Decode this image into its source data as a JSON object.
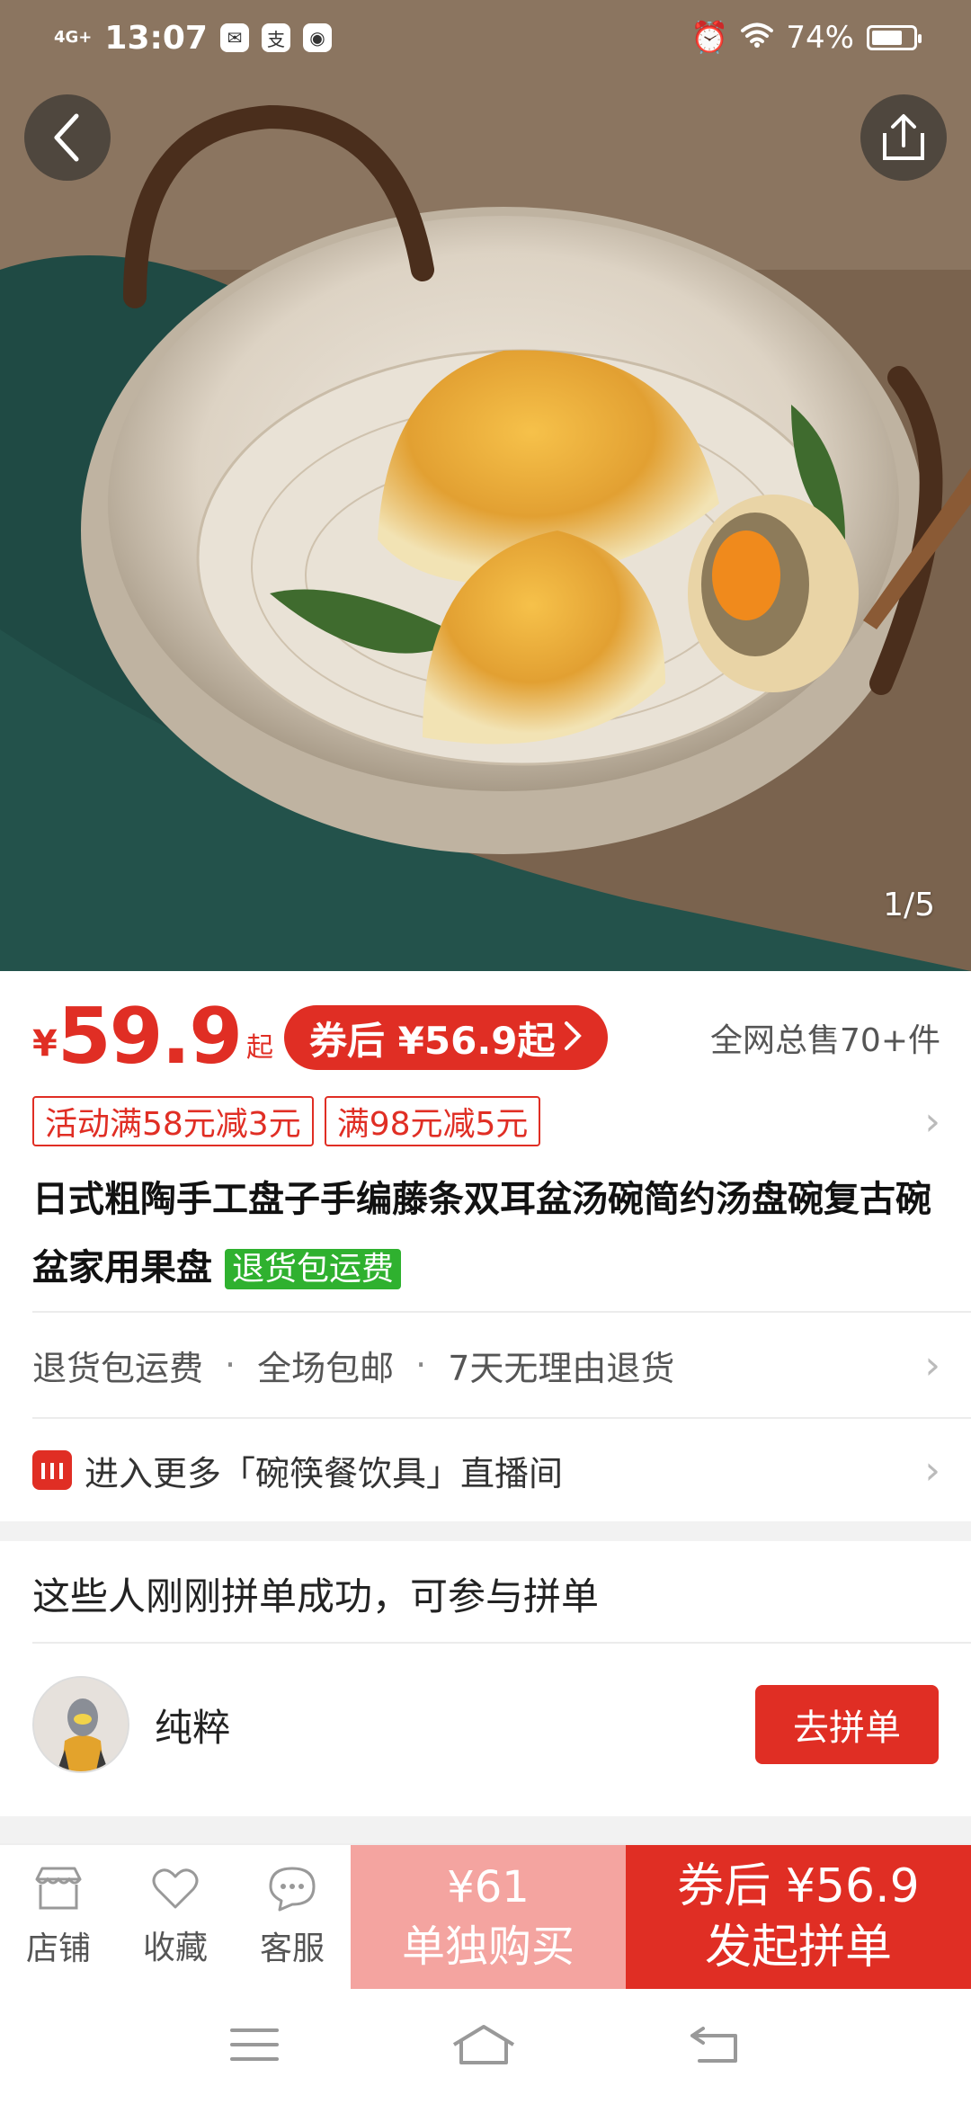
{
  "status_bar": {
    "network": "4G+",
    "time": "13:07",
    "battery_percent": "74%",
    "battery_level": 0.74
  },
  "hero": {
    "image_counter": "1/5"
  },
  "price": {
    "currency": "¥",
    "amount": "59.9",
    "suffix": "起",
    "coupon_label": "券后 ¥56.9起",
    "sales": "全网总售70+件"
  },
  "promos": [
    "活动满58元减3元",
    "满98元减5元"
  ],
  "product": {
    "title": "日式粗陶手工盘子手编藤条双耳盆汤碗简约汤盘碗复古碗盆家用果盘",
    "return_badge": "退货包运费"
  },
  "services": {
    "items": [
      "退货包运费",
      "全场包邮",
      "7天无理由退货"
    ],
    "separator": "·"
  },
  "live": {
    "label": "进入更多「碗筷餐饮具」直播间"
  },
  "group_buy": {
    "title": "这些人刚刚拼单成功，可参与拼单",
    "member_name": "纯粹",
    "join_label": "去拼单"
  },
  "bottom_bar": {
    "store": "店铺",
    "favorite": "收藏",
    "service": "客服",
    "single_price": "¥61",
    "single_label": "单独购买",
    "group_price": "券后 ¥56.9",
    "group_label": "发起拼单"
  },
  "colors": {
    "accent": "#e02e24",
    "accent_light": "#f4a4a0",
    "badge_green": "#2fb12f"
  }
}
